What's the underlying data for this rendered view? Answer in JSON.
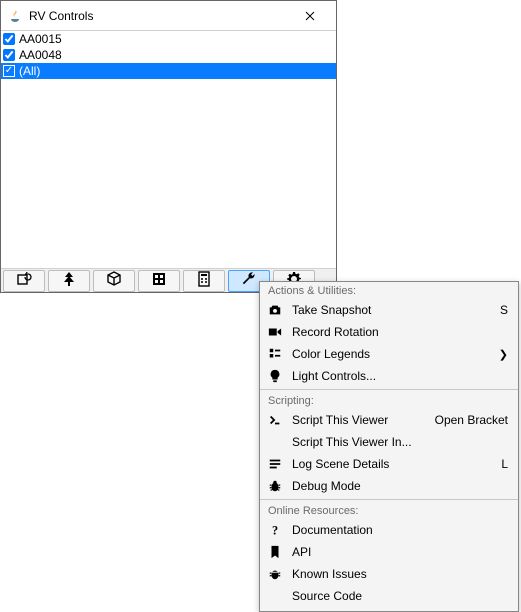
{
  "window": {
    "title": "RV Controls"
  },
  "list": {
    "items": [
      {
        "label": "AA0015",
        "checked": true,
        "selected": false
      },
      {
        "label": "AA0048",
        "checked": true,
        "selected": false
      },
      {
        "label": "(All)",
        "checked": true,
        "selected": true
      }
    ]
  },
  "toolbar": {
    "buttons": [
      {
        "name": "box-refresh-icon"
      },
      {
        "name": "tree-icon"
      },
      {
        "name": "cube-icon"
      },
      {
        "name": "grid-icon"
      },
      {
        "name": "calc-icon"
      },
      {
        "name": "wrench-icon"
      },
      {
        "name": "gear-icon"
      }
    ],
    "active": "wrench-icon"
  },
  "menu": {
    "sections": [
      {
        "header": "Actions & Utilities:",
        "items": [
          {
            "icon": "camera-icon",
            "label": "Take Snapshot",
            "shortcut": "S"
          },
          {
            "icon": "record-icon",
            "label": "Record Rotation"
          },
          {
            "icon": "legend-icon",
            "label": "Color Legends",
            "submenu": true
          },
          {
            "icon": "bulb-icon",
            "label": "Light Controls..."
          }
        ]
      },
      {
        "header": "Scripting:",
        "items": [
          {
            "icon": "terminal-icon",
            "label": "Script This Viewer",
            "shortcut": "Open Bracket"
          },
          {
            "icon": "",
            "label": "Script This Viewer In..."
          },
          {
            "icon": "lines-icon",
            "label": "Log Scene Details",
            "shortcut": "L"
          },
          {
            "icon": "bug-icon",
            "label": "Debug Mode"
          }
        ]
      },
      {
        "header": "Online Resources:",
        "items": [
          {
            "icon": "question-icon",
            "label": "Documentation"
          },
          {
            "icon": "bookmark-icon",
            "label": "API"
          },
          {
            "icon": "issues-icon",
            "label": "Known Issues"
          },
          {
            "icon": "",
            "label": "Source Code"
          }
        ]
      }
    ]
  }
}
